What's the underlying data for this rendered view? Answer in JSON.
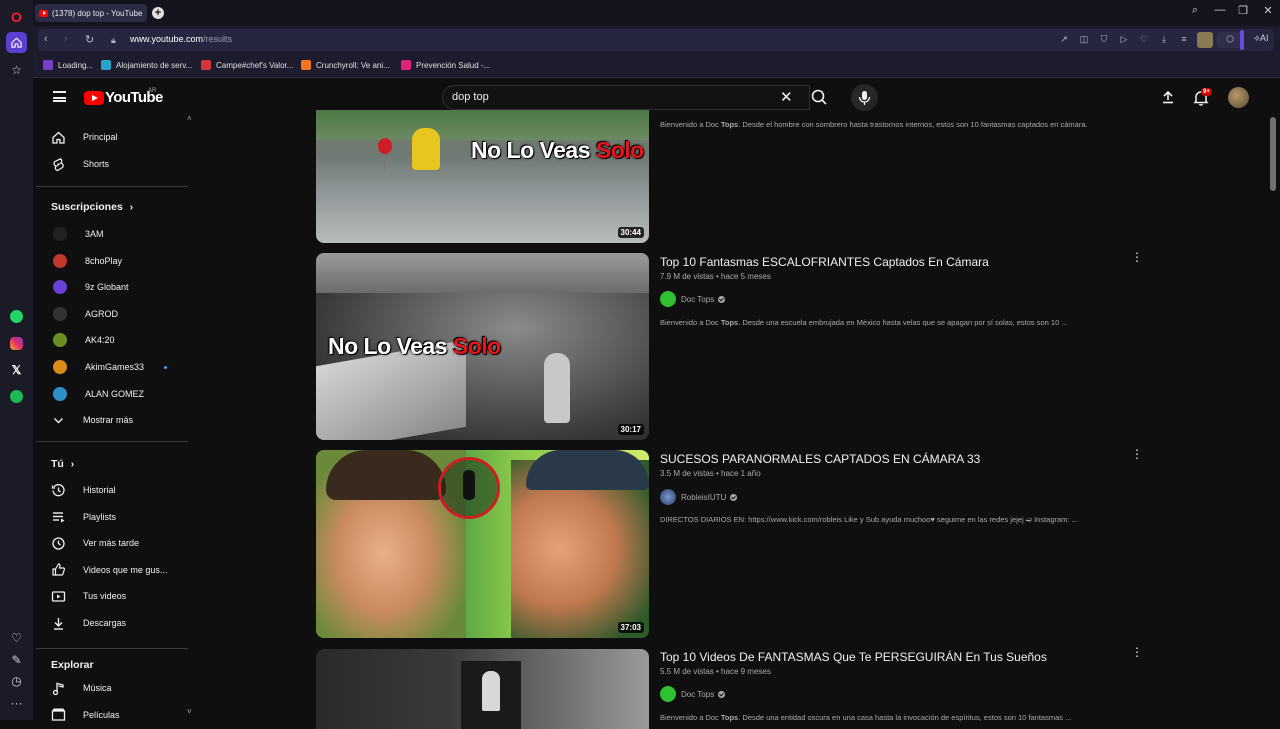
{
  "browser": {
    "tab_title": "(1378) dop top - YouTube",
    "url_host": "www.youtube.com",
    "url_path": "/results",
    "ai_label": "AI",
    "bookmarks": [
      {
        "label": "Loading...",
        "color": "#7a3fc8"
      },
      {
        "label": "Alojamiento de serv...",
        "color": "#2aa3c9"
      },
      {
        "label": "Campe#chef's Valor...",
        "color": "#d4343a"
      },
      {
        "label": "Crunchyroll: Ve ani...",
        "color": "#f47521"
      },
      {
        "label": "Prevención Salud -...",
        "color": "#e0227a"
      }
    ]
  },
  "youtube": {
    "logo_text": "YouTube",
    "country_code": "AR",
    "search_query": "dop top",
    "notif_badge": "9+"
  },
  "sidebar": {
    "main": [
      {
        "label": "Principal",
        "icon": "home-icon"
      },
      {
        "label": "Shorts",
        "icon": "shorts-icon"
      }
    ],
    "subscriptions_heading": "Suscripciones",
    "subscriptions": [
      {
        "label": "3AM",
        "color": "#222"
      },
      {
        "label": "8choPlay",
        "color": "#c0392b"
      },
      {
        "label": "9z Globant",
        "color": "#6a3fd8"
      },
      {
        "label": "AGROD",
        "color": "#333"
      },
      {
        "label": "AK4:20",
        "color": "#6b8e23"
      },
      {
        "label": "AkimGames33",
        "color": "#d98c1a"
      },
      {
        "label": "ALAN GOMEZ",
        "color": "#2f8fc9"
      }
    ],
    "show_more": "Mostrar más",
    "you_heading": "Tú",
    "you_items": [
      {
        "label": "Historial",
        "icon": "history-icon"
      },
      {
        "label": "Playlists",
        "icon": "playlists-icon"
      },
      {
        "label": "Ver más tarde",
        "icon": "watch-later-icon"
      },
      {
        "label": "Videos que me gus...",
        "icon": "like-icon"
      },
      {
        "label": "Tus videos",
        "icon": "your-videos-icon"
      },
      {
        "label": "Descargas",
        "icon": "download-icon"
      }
    ],
    "explore_heading": "Explorar",
    "explore_items": [
      {
        "label": "Música",
        "icon": "music-icon"
      },
      {
        "label": "Películas",
        "icon": "movies-icon"
      }
    ]
  },
  "results": [
    {
      "title": "",
      "meta": "",
      "channel": "",
      "desc_prefix": "Bienvenido a Doc ",
      "desc_bold": "Tops",
      "desc_suffix": ". Desde el hombre con sombrero hasta trastornos internos, estos son 10 fantasmas captados en cámara.",
      "duration": "30:44",
      "overlay_white": "No Lo Veas ",
      "overlay_red": "Solo"
    },
    {
      "title": "Top 10 Fantasmas ESCALOFRIANTES Captados En Cámara",
      "meta": "7.9 M de vistas • hace 5 meses",
      "channel": "Doc Tops",
      "desc_prefix": "Bienvenido a Doc ",
      "desc_bold": "Tops",
      "desc_suffix": ". Desde una escuela embrujada en México hasta velas que se apagan por sí solas, estos son 10 ...",
      "duration": "30:17",
      "overlay_white": "No Lo Veas ",
      "overlay_red": "Solo"
    },
    {
      "title": "SUCESOS PARANORMALES CAPTADOS EN CÁMARA 33",
      "meta": "3.5 M de vistas • hace 1 año",
      "channel": "RobleisIUTU",
      "desc_prefix": "DIRECTOS DIARIOS EN: https://www.kick.com/robleis Like y Sub ayuda muchoo♥ seguime en las redes jejej ➫ Instagram: ...",
      "desc_bold": "",
      "desc_suffix": "",
      "duration": "37:03"
    },
    {
      "title": "Top 10 Videos De FANTASMAS Que Te PERSEGUIRÁN En Tus Sueños",
      "meta": "5.5 M de vistas • hace 9 meses",
      "channel": "Doc Tops",
      "desc_prefix": "Bienvenido a Doc ",
      "desc_bold": "Tops",
      "desc_suffix": ". Desde una entidad oscura en una casa hasta la invocación de espíritus, estos son 10 fantasmas ...",
      "duration": ""
    }
  ]
}
